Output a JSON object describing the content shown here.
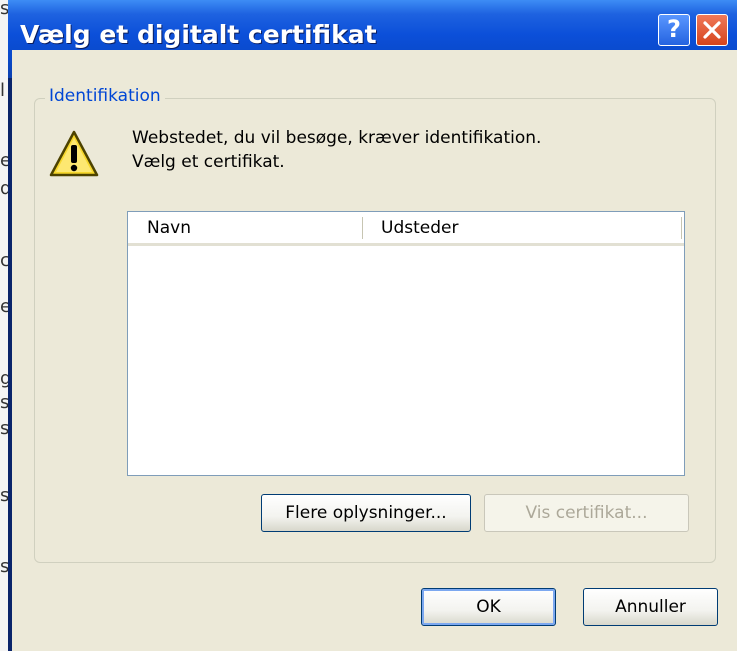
{
  "background": {
    "fragments": [
      "s",
      "l",
      "e",
      "d",
      "c",
      "e",
      "g",
      "s",
      "s",
      "s",
      "s"
    ]
  },
  "window": {
    "title": "Vælg et digitalt certifikat",
    "help_label": "?",
    "close_icon": "close-icon"
  },
  "group": {
    "label": "Identifikation",
    "icon": "warning-icon",
    "message_line1": "Webstedet, du vil besøge, kræver identifikation.",
    "message_line2": "Vælg et certifikat."
  },
  "certificate_list": {
    "columns": [
      "Navn",
      "Udsteder"
    ],
    "rows": []
  },
  "buttons": {
    "more_info": "Flere oplysninger...",
    "view_certificate": "Vis certifikat...",
    "ok": "OK",
    "cancel": "Annuller"
  },
  "colors": {
    "titlebar_blue": "#0b4fd9",
    "group_label": "#0046d5",
    "dialog_face": "#ece9d8"
  }
}
